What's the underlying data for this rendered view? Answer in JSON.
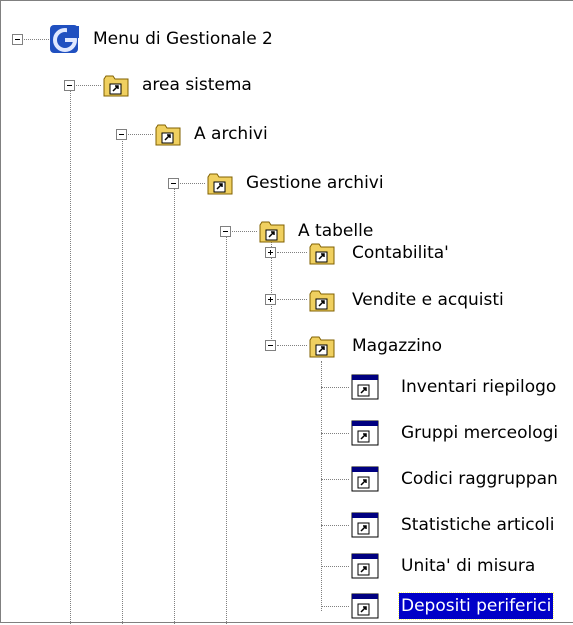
{
  "tree": {
    "root": {
      "label": "Menu di Gestionale 2",
      "icon": "app-logo-icon"
    },
    "items": [
      {
        "label": "area sistema",
        "icon": "folder-shortcut-icon",
        "expander": "minus"
      },
      {
        "label": "A archivi",
        "icon": "folder-shortcut-icon",
        "expander": "minus"
      },
      {
        "label": "Gestione archivi",
        "icon": "folder-shortcut-icon",
        "expander": "minus"
      },
      {
        "label": "A tabelle",
        "icon": "folder-shortcut-icon",
        "expander": "minus"
      },
      {
        "label": "Contabilita'",
        "icon": "folder-shortcut-icon",
        "expander": "plus"
      },
      {
        "label": "Vendite e acquisti",
        "icon": "folder-shortcut-icon",
        "expander": "plus"
      },
      {
        "label": "Magazzino",
        "icon": "folder-shortcut-icon",
        "expander": "minus"
      },
      {
        "label": "Inventari riepilogo",
        "icon": "window-shortcut-icon"
      },
      {
        "label": "Gruppi merceologi",
        "icon": "window-shortcut-icon"
      },
      {
        "label": "Codici raggruppan",
        "icon": "window-shortcut-icon"
      },
      {
        "label": "Statistiche articoli",
        "icon": "window-shortcut-icon"
      },
      {
        "label": "Unita' di misura",
        "icon": "window-shortcut-icon"
      },
      {
        "label": "Depositi periferici",
        "icon": "window-shortcut-icon",
        "selected": true
      }
    ]
  },
  "colors": {
    "selection": "#0000c8",
    "folder": "#f0d060",
    "window_title": "#000080"
  }
}
